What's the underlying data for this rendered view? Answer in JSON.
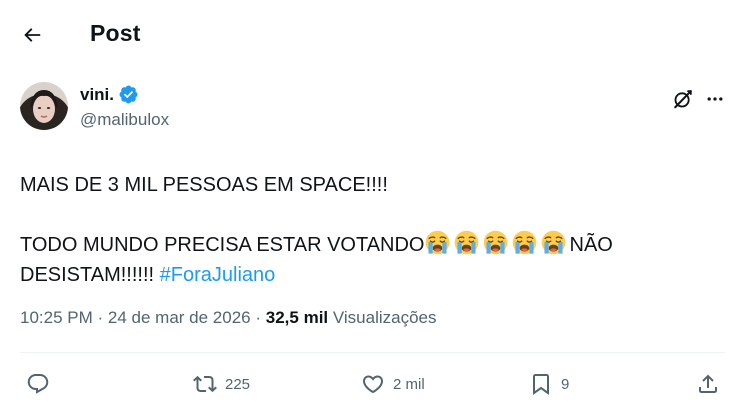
{
  "header": {
    "title": "Post"
  },
  "author": {
    "display_name": "vini.",
    "handle": "@malibulox"
  },
  "tweet": {
    "line1": "MAIS DE 3 MIL PESSOAS EM SPACE!!!!",
    "line2_prefix": "TODO MUNDO PRECISA ESTAR VOTANDO",
    "line2_suffix": "NÃO",
    "line3_prefix": "DESISTAM!!!!!!",
    "hashtag": "#ForaJuliano",
    "emoji_name": "loudly-crying-face",
    "emoji_count": 5
  },
  "meta": {
    "time": "10:25 PM",
    "separator": "·",
    "date": "24 de mar de 2026",
    "views_count": "32,5 mil",
    "views_label": "Visualizações"
  },
  "actions": {
    "reply_count": "",
    "repost_count": "225",
    "like_count": "2 mil",
    "bookmark_count": "9"
  },
  "colors": {
    "accent": "#1d9bf0",
    "text": "#0f1419",
    "secondary": "#536471",
    "divider": "#eff3f4"
  }
}
